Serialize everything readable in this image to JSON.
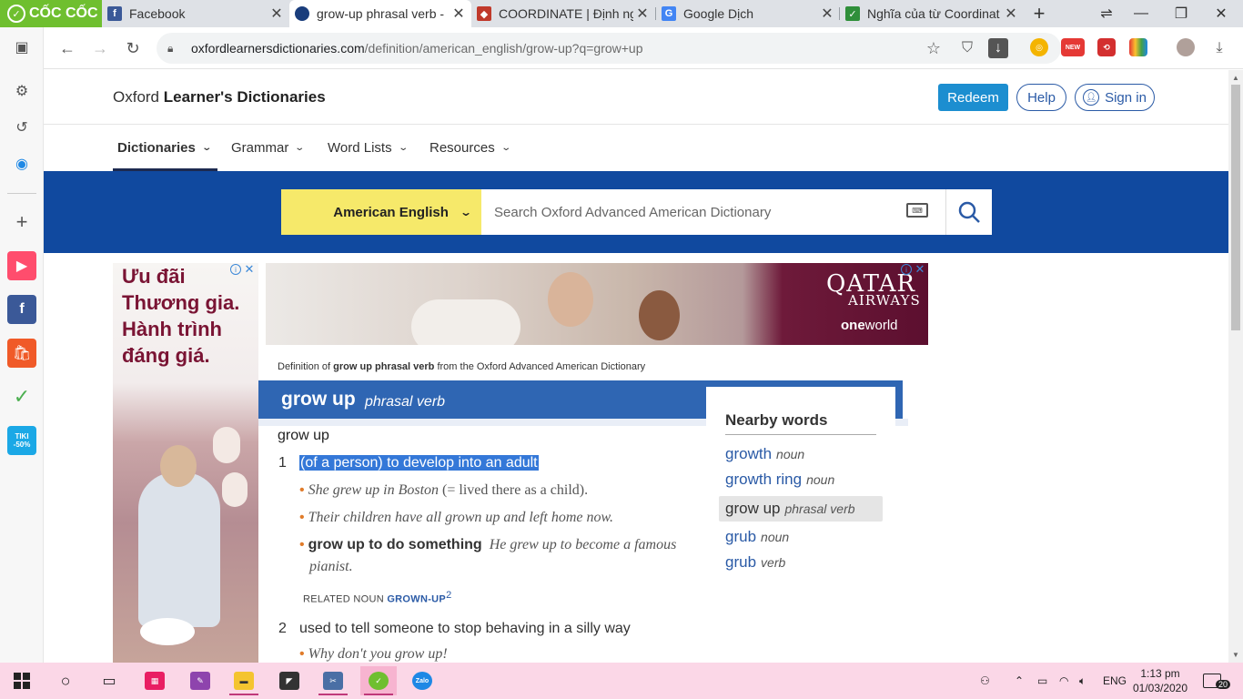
{
  "browser": {
    "brand": "CỐC CỐC",
    "tabs": [
      {
        "title": "Facebook",
        "favicon_color": "#3b5998",
        "favicon_glyph": "f",
        "icon": "facebook-icon"
      },
      {
        "title": "grow-up phrasal verb -",
        "favicon_color": "#1a3d7c",
        "favicon_glyph": "●",
        "icon": "oxford-icon"
      },
      {
        "title": "COORDINATE | Định ng",
        "favicon_color": "#c0392b",
        "favicon_glyph": "◆",
        "icon": "cambridge-icon"
      },
      {
        "title": "Google Dịch",
        "favicon_color": "#4285f4",
        "favicon_glyph": "G",
        "icon": "google-translate-icon"
      },
      {
        "title": "Nghĩa của từ Coordinat",
        "favicon_color": "#2f8f3a",
        "favicon_glyph": "✓",
        "icon": "dictionary-icon"
      }
    ],
    "url_host": "oxfordlearnersdictionaries.com",
    "url_path": "/definition/american_english/grow-up?q=grow+up",
    "new_badge": "NEW",
    "tiki_badge": "TIKI -50%"
  },
  "site": {
    "logo_light": "Oxford ",
    "logo_bold": "Learner's Dictionaries",
    "redeem": "Redeem",
    "help": "Help",
    "sign_in": "Sign in",
    "nav": [
      "Dictionaries",
      "Grammar",
      "Word Lists",
      "Resources"
    ],
    "dict_select": "American English",
    "search_placeholder": "Search Oxford Advanced American Dictionary"
  },
  "ads": {
    "left_text": "Ưu đãi Thương gia. Hành trình đáng giá.",
    "top_brand": "QATAR",
    "top_brand2": "AIRWAYS",
    "top_alliance_bold": "one",
    "top_alliance": "world"
  },
  "entry": {
    "source_prefix": "Definition of ",
    "source_bold": "grow up phrasal verb",
    "source_suffix": " from the Oxford Advanced American Dictionary",
    "headword": "grow up",
    "pos": "phrasal verb",
    "phrase": "grow up",
    "sense1_num": "1",
    "sense1_def": "(of a person) to develop into an adult",
    "ex1_italic": "She grew up in Boston",
    "ex1_plain": " (= lived there as a child).",
    "ex2": "Their children have all grown up and left home now.",
    "ex3_cf": "grow up to do something",
    "ex3": "He grew up to become a famous pianist.",
    "related_label": "RELATED NOUN ",
    "related_link": "GROWN-UP",
    "related_sup": "2",
    "sense2_num": "2",
    "sense2_def": "used to tell someone to stop behaving in a silly way",
    "ex4": "Why don't you grow up!"
  },
  "nearby": {
    "title": "Nearby words",
    "items": [
      {
        "word": "growth",
        "pos": "noun"
      },
      {
        "word": "growth ring",
        "pos": "noun"
      },
      {
        "word": "grow up",
        "pos": "phrasal verb"
      },
      {
        "word": "grub",
        "pos": "noun"
      },
      {
        "word": "grub",
        "pos": "verb"
      }
    ]
  },
  "taskbar": {
    "lang": "ENG",
    "time": "1:13 pm",
    "date": "01/03/2020",
    "notifications": "20"
  }
}
